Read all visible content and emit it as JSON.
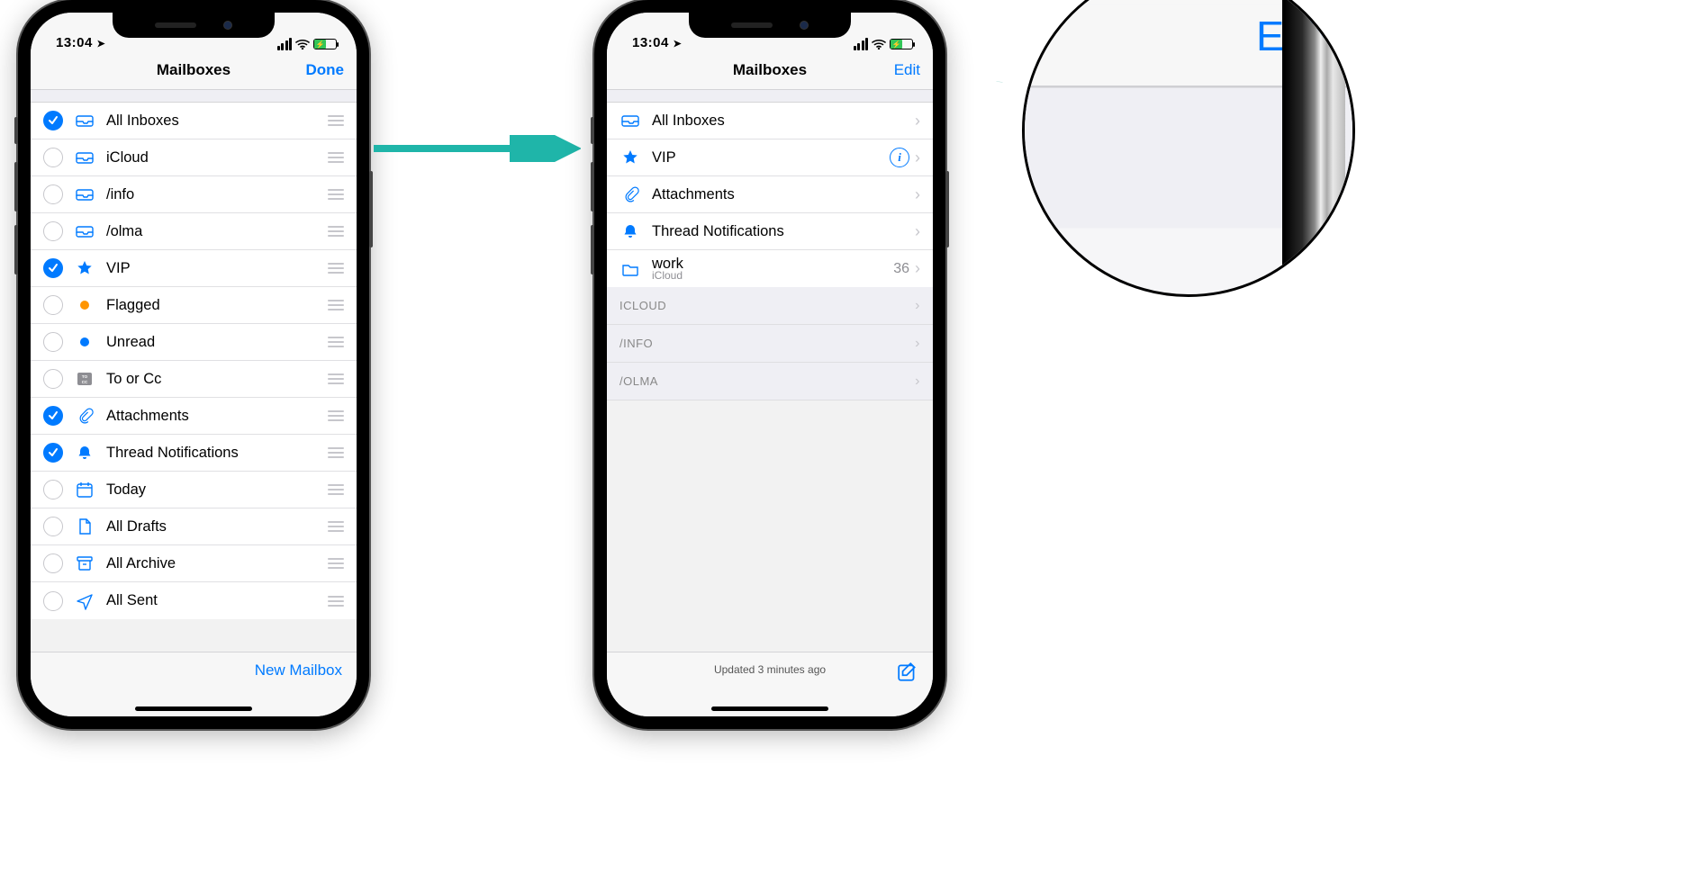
{
  "status": {
    "time": "13:04"
  },
  "accent": "#007aff",
  "phone1": {
    "title": "Mailboxes",
    "nav_action": "Done",
    "rows": [
      {
        "checked": true,
        "icon": "inbox",
        "label": "All Inboxes"
      },
      {
        "checked": false,
        "icon": "inbox",
        "label": "iCloud"
      },
      {
        "checked": false,
        "icon": "inbox",
        "label": "/info"
      },
      {
        "checked": false,
        "icon": "inbox",
        "label": "/olma"
      },
      {
        "checked": true,
        "icon": "star",
        "label": "VIP"
      },
      {
        "checked": false,
        "icon": "dot-orange",
        "label": "Flagged"
      },
      {
        "checked": false,
        "icon": "dot-blue",
        "label": "Unread"
      },
      {
        "checked": false,
        "icon": "tocc",
        "label": "To or Cc"
      },
      {
        "checked": true,
        "icon": "paperclip",
        "label": "Attachments"
      },
      {
        "checked": true,
        "icon": "bell",
        "label": "Thread Notifications"
      },
      {
        "checked": false,
        "icon": "calendar",
        "label": "Today"
      },
      {
        "checked": false,
        "icon": "doc",
        "label": "All Drafts"
      },
      {
        "checked": false,
        "icon": "archive",
        "label": "All Archive"
      },
      {
        "checked": false,
        "icon": "send",
        "label": "All Sent"
      }
    ],
    "footer_action": "New Mailbox"
  },
  "phone2": {
    "title": "Mailboxes",
    "nav_action": "Edit",
    "rows": [
      {
        "icon": "inbox",
        "label": "All Inboxes",
        "accessory": "chevron"
      },
      {
        "icon": "star",
        "label": "VIP",
        "accessory": "info"
      },
      {
        "icon": "paperclip",
        "label": "Attachments",
        "accessory": "chevron"
      },
      {
        "icon": "bell",
        "label": "Thread Notifications",
        "accessory": "chevron"
      },
      {
        "icon": "folder",
        "label": "work",
        "sub": "iCloud",
        "count": "36",
        "accessory": "chevron"
      }
    ],
    "sections": [
      "ICLOUD",
      "/INFO",
      "/OLMA"
    ],
    "footer_text": "Updated 3 minutes ago"
  },
  "zoom": {
    "edit_label": "Edit"
  }
}
